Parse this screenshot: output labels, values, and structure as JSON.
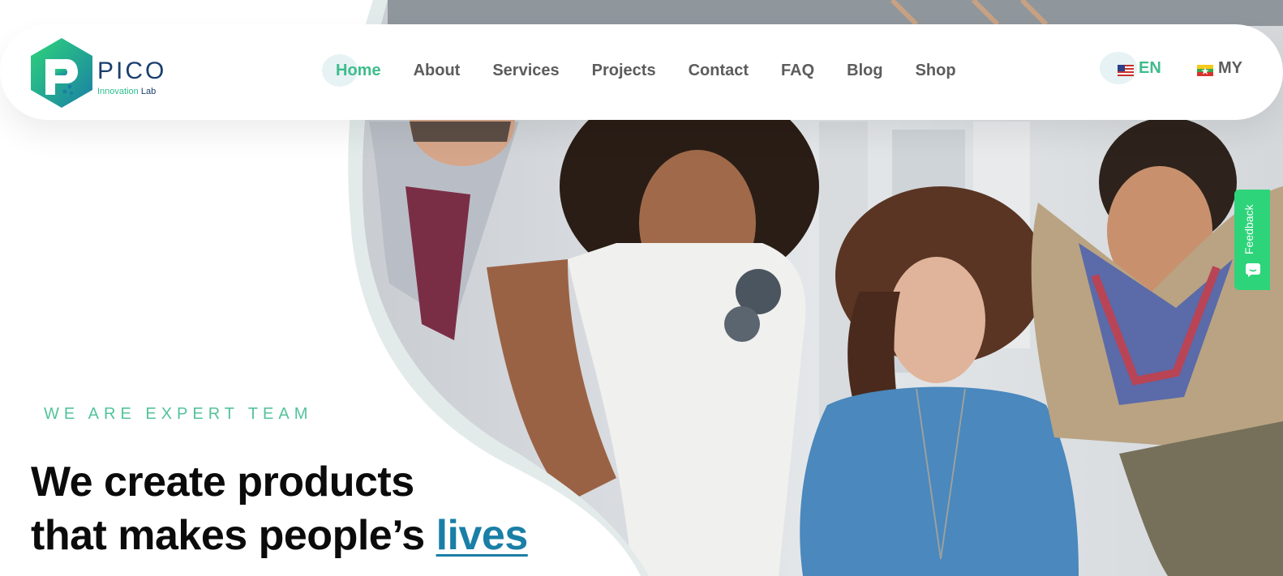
{
  "brand": {
    "name": "PICO",
    "sub_primary": "Innovation",
    "sub_secondary": "Lab",
    "colors": {
      "green": "#2cbf8c",
      "navy": "#1a3f6e",
      "teal": "#1a7fa6"
    }
  },
  "nav": {
    "items": [
      {
        "label": "Home",
        "active": true
      },
      {
        "label": "About"
      },
      {
        "label": "Services"
      },
      {
        "label": "Projects"
      },
      {
        "label": "Contact"
      },
      {
        "label": "FAQ"
      },
      {
        "label": "Blog"
      },
      {
        "label": "Shop"
      }
    ]
  },
  "languages": {
    "en": {
      "label": "EN",
      "icon": "us-flag-icon",
      "active": true
    },
    "my": {
      "label": "MY",
      "icon": "myanmar-flag-icon"
    }
  },
  "hero": {
    "tagline": "WE ARE EXPERT TEAM",
    "headline_line1": "We create products",
    "headline_line2_prefix": "that makes people’s ",
    "headline_highlight": "lives"
  },
  "feedback": {
    "label": "Feedback",
    "icon": "chat-face-icon"
  }
}
